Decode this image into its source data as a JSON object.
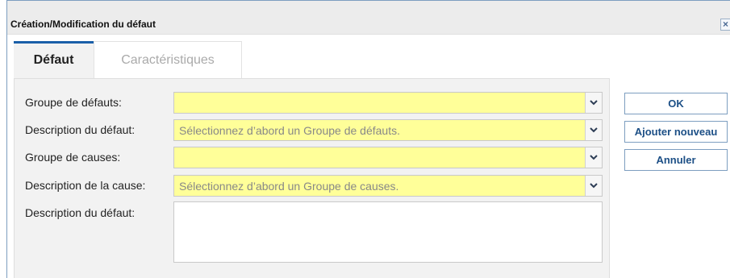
{
  "dialog": {
    "title": "Création/Modification du défaut",
    "close_label": "×"
  },
  "tabs": [
    {
      "label": "Défaut",
      "active": true
    },
    {
      "label": "Caractéristiques",
      "active": false
    }
  ],
  "form": {
    "fields": [
      {
        "label": "Groupe de défauts:",
        "value": "",
        "placeholder": ""
      },
      {
        "label": "Description du défaut:",
        "value": "",
        "placeholder": "Sélectionnez d’abord un Groupe de défauts."
      },
      {
        "label": "Groupe de causes:",
        "value": "",
        "placeholder": ""
      },
      {
        "label": "Description de la cause:",
        "value": "",
        "placeholder": "Sélectionnez d’abord un Groupe de causes."
      }
    ],
    "description": {
      "label": "Description du défaut:",
      "value": ""
    }
  },
  "buttons": {
    "ok": "OK",
    "add_new": "Ajouter nouveau",
    "cancel": "Annuler"
  },
  "colors": {
    "required_field": "#ffff99",
    "accent": "#1a5fa8",
    "button_text": "#1c4f86"
  },
  "icons": {
    "dropdown": "chevron-down-icon",
    "close": "close-icon"
  }
}
